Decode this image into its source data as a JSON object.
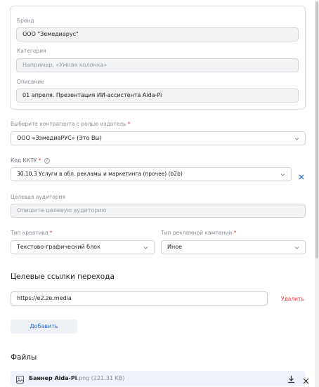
{
  "brand": {
    "label": "Бренд",
    "value": "ООО \"Земедиарус\""
  },
  "category": {
    "label": "Категория",
    "placeholder": "Например, «Умная колонка»"
  },
  "description": {
    "label": "Описание",
    "value": "01 апреля. Презентация ИИ-ассистента Aida-Pi"
  },
  "contractor": {
    "label": "Выберите контрагента с ролью издатель",
    "required_mark": "*",
    "value": "ООО «ЗэмедиаРУС» (Это Вы)"
  },
  "kktu": {
    "label": "Код ККТУ",
    "required_mark": "*",
    "help_icon": "question-circle-icon",
    "value": "30.10.3 Услуги в обл. рекламы и маркетинга (прочее) (b2b)"
  },
  "audience": {
    "label": "Целевая аудитория",
    "placeholder": "Опишите целевую аудиторию"
  },
  "creative_type": {
    "label": "Тип креатива",
    "required_mark": "*",
    "value": "Текстово-графический блок"
  },
  "campaign_type": {
    "label": "Тип рекламной кампании",
    "required_mark": "*",
    "value": "Иное"
  },
  "links": {
    "title": "Целевые ссылки перехода",
    "items": [
      {
        "url": "https://e2.ze.media",
        "delete_label": "Удалить"
      }
    ],
    "add_label": "Добавить"
  },
  "files": {
    "title": "Файлы",
    "items": [
      {
        "name": "Баннер Aida-Pi",
        "meta": ".png (221.31 KB)"
      }
    ]
  },
  "colors": {
    "accent": "#2f6fd6",
    "danger": "#e03b3b",
    "muted": "#8a8f99"
  }
}
